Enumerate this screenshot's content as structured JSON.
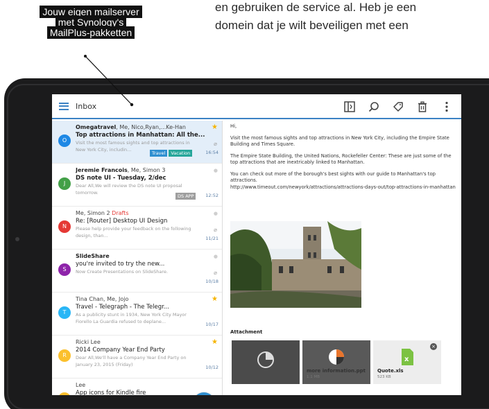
{
  "page_text": {
    "line1": "en gebruiken de service al. Heb je een",
    "line2": "domein dat je wilt beveiligen met een"
  },
  "caption": {
    "line1": "Jouw eigen mailserver",
    "line2": "met Synology's",
    "line3": "MailPlus-pakketten"
  },
  "toolbar": {
    "title": "Inbox",
    "icons": [
      "menu-icon",
      "panel-toggle-icon",
      "search-icon",
      "tag-icon",
      "trash-icon",
      "more-vert-icon"
    ]
  },
  "mails": [
    {
      "initial": "O",
      "color": "#1e88e5",
      "from_bold": "Omegatravel",
      "from_rest": ", Me, Nico,Ryan,...Ke-Han",
      "subject": "Top attractions in Manhattan: All the...",
      "preview": "Visit the most famous sights and top attractions in New York City, includin...",
      "date": "16:54",
      "tags": [
        "Travel",
        "Vacation"
      ],
      "starred": true
    },
    {
      "initial": "J",
      "color": "#43a047",
      "from_bold": "Jeremie Francois",
      "from_rest": ", Me, Simon 3",
      "subject": "DS note UI - Tuesday, 2/dec",
      "preview": "Dear All,We will review the DS note UI proposal tomorrow.",
      "date": "12:52",
      "tags": [
        "DS APP"
      ],
      "starred": false
    },
    {
      "initial": "N",
      "color": "#e53935",
      "from_plain": "Me, Simon 2",
      "drafts": "Drafts",
      "subject": "Re: [Router] Desktop UI Design",
      "preview": "Please help provide your feedback on the following design, than...",
      "date": "11/21",
      "starred": false
    },
    {
      "initial": "S",
      "color": "#8e24aa",
      "from_bold": "SlideShare",
      "subject": "you're invited to try the new...",
      "preview": "Now Create Presentations on SlideShare.",
      "date": "10/18",
      "starred": false
    },
    {
      "initial": "T",
      "color": "#29b6f6",
      "from_plain": "Tina Chan, Me, Jojo",
      "subject": "Travel - Telegraph - The Telegr...",
      "preview": "As a publicity stunt in 1934, New York City Mayor Fiorello La Guardia refused to deplane...",
      "date": "10/17",
      "starred": true
    },
    {
      "initial": "R",
      "color": "#fbc02d",
      "from_plain": "Ricki Lee",
      "subject": "2014 Company Year End Party",
      "preview": "Dear All,We'll have a Company Year End Party on January 23, 2015 (Friday)",
      "date": "10/12",
      "starred": true
    },
    {
      "initial": "P",
      "color": "#fbc02d",
      "from_plain": "Lee",
      "subject": "App icons for Kindle fire",
      "preview": "",
      "date": "",
      "starred": false
    }
  ],
  "message": {
    "greeting": "Hi,",
    "p1": "Visit the most famous sights and top attractions in New York City, including the Empire State Building and Times Square.",
    "p2": "The Empire State Building, the United Nations, Rockefeller Center: These are just some of the top attractions that are inextricably linked to Manhattan.",
    "p3": "You can check out more of the borough's best sights with our guide to Manhattan's top attractions.",
    "p4": "http://www.timeout.com/newyork/attractions/attractions-days-out/top-attractions-in-manhattan"
  },
  "attachments": {
    "title": "Attachment",
    "items": [
      {
        "name": "",
        "size": ""
      },
      {
        "name": "more information.ppt",
        "size": "1.1 MB"
      },
      {
        "name": "Quote.xls",
        "size": "523 KB"
      }
    ]
  },
  "compose_icon": "pencil-icon"
}
